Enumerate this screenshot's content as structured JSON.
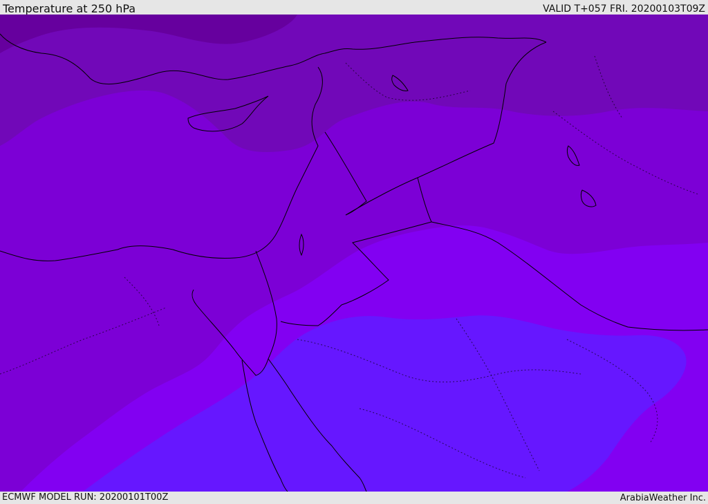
{
  "header": {
    "title": "Temperature at 250 hPa",
    "valid": "VALID T+057 FRI. 20200103T09Z"
  },
  "footer": {
    "model_run": "ECMWF MODEL RUN: 20200101T00Z",
    "credit": "ArabiaWeather Inc."
  },
  "palette": {
    "coldest": "#66009e",
    "cold": "#7108b8",
    "mid": "#7c00d6",
    "warm": "#8200f2",
    "warmer": "#6617ff",
    "coastline": "#000000"
  }
}
